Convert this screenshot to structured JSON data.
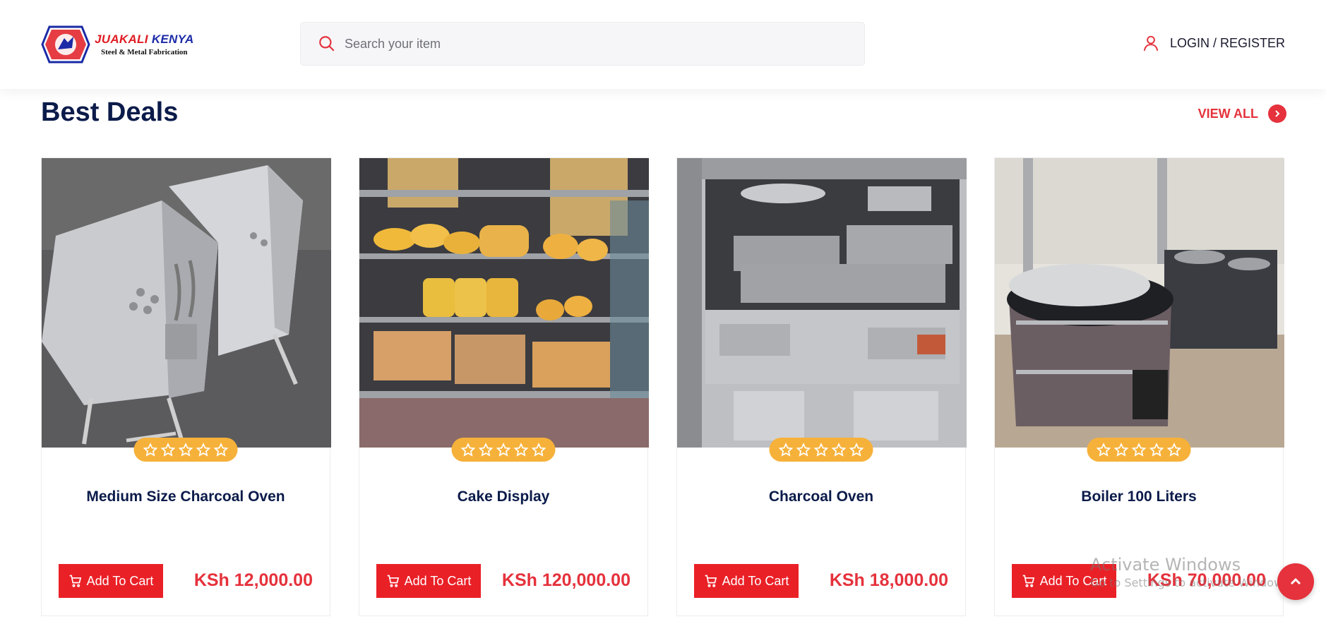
{
  "header": {
    "logo_title_red": "JUAKALI",
    "logo_title_blue": "KENYA",
    "logo_subtitle": "Steel & Metal Fabrication",
    "search_placeholder": "Search your item",
    "login_label": "LOGIN / REGISTER"
  },
  "section": {
    "title": "Best Deals",
    "view_all": "VIEW ALL"
  },
  "products": [
    {
      "name": "Medium Size Charcoal Oven",
      "price": "KSh 12,000.00",
      "button": "Add To Cart",
      "rating": 0
    },
    {
      "name": "Cake Display",
      "price": "KSh 120,000.00",
      "button": "Add To Cart",
      "rating": 0
    },
    {
      "name": "Charcoal Oven",
      "price": "KSh 18,000.00",
      "button": "Add To Cart",
      "rating": 0
    },
    {
      "name": "Boiler 100 Liters",
      "price": "KSh 70,000.00",
      "button": "Add To Cart",
      "rating": 0
    }
  ],
  "watermark": {
    "line1": "Activate Windows",
    "line2": "Go to Settings to activate Windows."
  },
  "colors": {
    "accent": "#e5323c",
    "button": "#ea2027",
    "stars_bg": "#f6b13a",
    "heading": "#0b1b4a"
  },
  "icons": [
    "search-icon",
    "user-icon",
    "chevron-right-icon",
    "star-outline-icon",
    "cart-icon",
    "chevron-up-icon"
  ]
}
